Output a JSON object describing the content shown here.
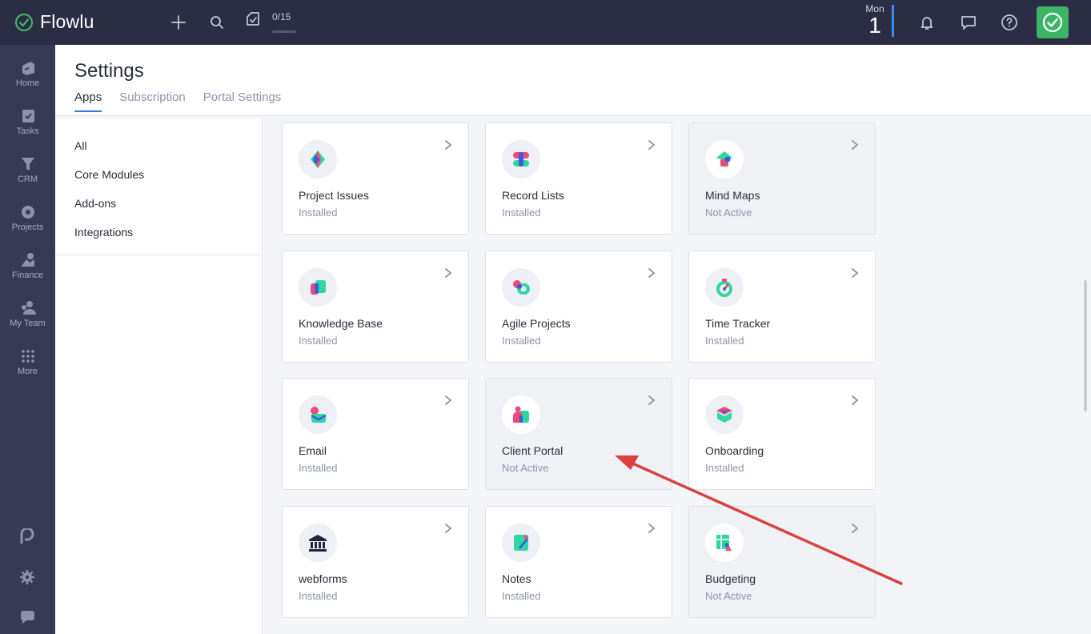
{
  "topbar": {
    "logo_text": "Flowlu",
    "progress_text": "0/15",
    "progress_fraction": 0,
    "date_day": "Mon",
    "date_num": "1"
  },
  "sidebar": {
    "items": [
      {
        "label": "Home",
        "icon": "home-icon"
      },
      {
        "label": "Tasks",
        "icon": "tasks-icon"
      },
      {
        "label": "CRM",
        "icon": "crm-icon"
      },
      {
        "label": "Projects",
        "icon": "projects-icon"
      },
      {
        "label": "Finance",
        "icon": "finance-icon"
      },
      {
        "label": "My Team",
        "icon": "team-icon"
      },
      {
        "label": "More",
        "icon": "grid-icon"
      }
    ]
  },
  "header": {
    "title": "Settings",
    "tabs": [
      {
        "label": "Apps"
      },
      {
        "label": "Subscription"
      },
      {
        "label": "Portal Settings"
      }
    ]
  },
  "filters": [
    {
      "label": "All"
    },
    {
      "label": "Core Modules"
    },
    {
      "label": "Add-ons"
    },
    {
      "label": "Integrations"
    }
  ],
  "apps": [
    {
      "name": "Project Issues",
      "status": "Installed"
    },
    {
      "name": "Record Lists",
      "status": "Installed"
    },
    {
      "name": "Mind Maps",
      "status": "Not Active"
    },
    {
      "name": "Knowledge Base",
      "status": "Installed"
    },
    {
      "name": "Agile Projects",
      "status": "Installed"
    },
    {
      "name": "Time Tracker",
      "status": "Installed"
    },
    {
      "name": "Email",
      "status": "Installed"
    },
    {
      "name": "Client Portal",
      "status": "Not Active"
    },
    {
      "name": "Onboarding",
      "status": "Installed"
    },
    {
      "name": "webforms",
      "status": "Installed"
    },
    {
      "name": "Notes",
      "status": "Installed"
    },
    {
      "name": "Budgeting",
      "status": "Not Active"
    }
  ],
  "colors": {
    "topbar": "#2b2d45",
    "sidebar": "#373a54",
    "accent_green": "#3db468",
    "accent_blue": "#3a75e0",
    "annotation_arrow": "#d9423f"
  }
}
